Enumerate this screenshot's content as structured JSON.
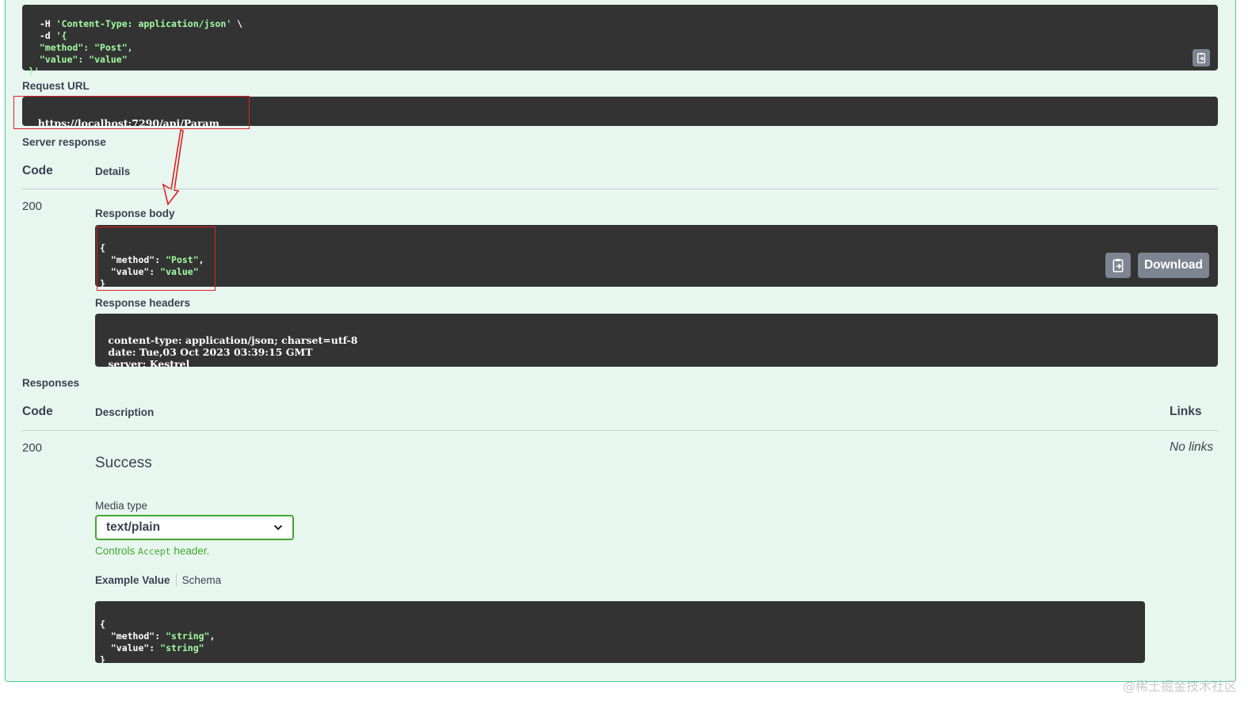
{
  "curl": {
    "lines": [
      {
        "pre": "  -H ",
        "str": "'Content-Type: application/json'",
        "post": " \\"
      },
      {
        "pre": "  -d ",
        "str": "'{",
        "post": ""
      },
      {
        "pre": "  ",
        "str": "\"method\": \"Post\",",
        "post": ""
      },
      {
        "pre": "  ",
        "str": "\"value\": \"value\"",
        "post": ""
      },
      {
        "pre": "",
        "str": "}'",
        "post": ""
      }
    ]
  },
  "request_url": {
    "label": "Request URL",
    "value": "https://localhost:7290/api/Param"
  },
  "server_response": {
    "label": "Server response",
    "code_header": "Code",
    "details_header": "Details",
    "code": "200",
    "body_label": "Response body",
    "body": {
      "open": "{",
      "line1_key": "  \"method\": ",
      "line1_val": "\"Post\"",
      "line1_end": ",",
      "line2_key": "  \"value\": ",
      "line2_val": "\"value\"",
      "close": "}"
    },
    "download_label": "Download",
    "headers_label": "Response headers",
    "headers": [
      " content-type: application/json; charset=utf-8 ",
      " date: Tue,03 Oct 2023 03:39:15 GMT ",
      " server: Kestrel "
    ]
  },
  "responses": {
    "label": "Responses",
    "code_header": "Code",
    "description_header": "Description",
    "links_header": "Links",
    "code": "200",
    "description": "Success",
    "links_value": "No links",
    "media_type_label": "Media type",
    "media_type_value": "text/plain",
    "controls_pre": "Controls ",
    "controls_code": "Accept",
    "controls_post": " header.",
    "tab_example": "Example Value",
    "tab_schema": "Schema",
    "example": {
      "open": "{",
      "line1_key": "  \"method\": ",
      "line1_val": "\"string\"",
      "line1_end": ",",
      "line2_key": "  \"value\": ",
      "line2_val": "\"string\"",
      "close": "}"
    }
  },
  "watermark": "@稀土掘金技术社区",
  "colors": {
    "panel_bg": "#e8f6f0",
    "panel_border": "#49cc90",
    "code_bg": "#333333",
    "string_green": "#a2fca2",
    "select_border": "#41a830",
    "annotation_red": "#e02020"
  },
  "icons": [
    "copy-to-clipboard-icon",
    "chevron-down-icon",
    "annotation-arrow"
  ]
}
